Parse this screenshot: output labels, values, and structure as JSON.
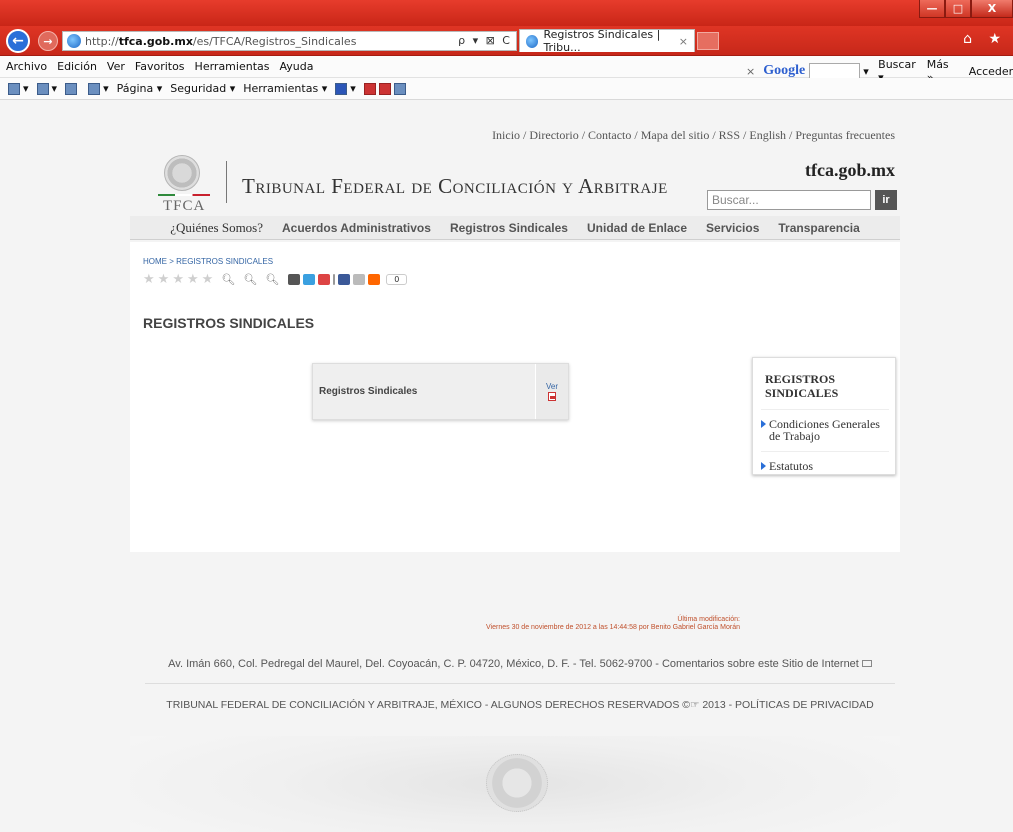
{
  "browser": {
    "url_prefix": "http://",
    "url_host": "tfca.gob.mx",
    "url_path": "/es/TFCA/Registros_Sindicales",
    "address_tools": "ρ ▾ ⊠ C",
    "tab_title": "Registros Sindicales | Tribu...",
    "tab_close": "×",
    "window_buttons": [
      "—",
      "□",
      "X"
    ],
    "home_star": "⌂ ★",
    "menu": [
      "Archivo",
      "Edición",
      "Ver",
      "Favoritos",
      "Herramientas",
      "Ayuda"
    ],
    "google": {
      "close": "×",
      "logo": "Google",
      "buscar": "Buscar ▾",
      "mas": "Más »",
      "acceder": "Acceder"
    },
    "commands": [
      "Página ▾",
      "Seguridad ▾",
      "Herramientas ▾"
    ]
  },
  "site": {
    "top_links": "Inicio / Directorio / Contacto / Mapa del sitio / RSS / English / Preguntas frecuentes",
    "logo_text": "TFCA",
    "title": "Tribunal Federal de Conciliación y Arbitraje",
    "domain": "tfca.gob.mx",
    "search_placeholder": "Buscar...",
    "search_button": "ir",
    "nav": [
      "¿Quiénes Somos?",
      "Acuerdos Administrativos",
      "Registros Sindicales",
      "Unidad de Enlace",
      "Servicios",
      "Transparencia"
    ]
  },
  "content": {
    "breadcrumb": "HOME > REGISTROS SINDICALES",
    "share_count": "0",
    "page_title": "REGISTROS SINDICALES",
    "table": {
      "row_label": "Registros Sindicales",
      "ver_label": "Ver"
    },
    "sidebar": {
      "title_line1": "REGISTROS",
      "title_line2": "SINDICALES",
      "items": [
        "Condiciones Generales de Trabajo",
        "Estatutos"
      ]
    },
    "last_modified_label": "Última modificación:",
    "last_modified_value": "Viernes 30 de noviembre de 2012 a las 14:44:58 por Benito Gabriel García Morán"
  },
  "footer": {
    "address": "Av. Imán 660, Col. Pedregal del Maurel, Del. Coyoacán, C. P. 04720, México, D. F. - Tel. 5062-9700 - Comentarios sobre este Sitio de Internet",
    "copyright": "TRIBUNAL FEDERAL DE CONCILIACIÓN Y ARBITRAJE, MÉXICO - ALGUNOS DERECHOS RESERVADOS ©☞ 2013 - POLÍTICAS DE PRIVACIDAD"
  },
  "colors": {
    "chrome_red": "#d52d1e",
    "link_blue": "#3465a4",
    "lastmod_orange": "#c0502c"
  }
}
